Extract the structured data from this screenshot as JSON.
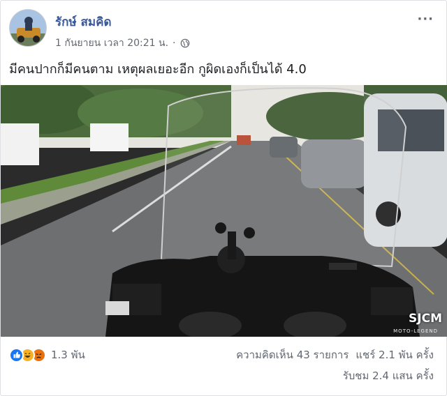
{
  "post": {
    "author": "รักษ์ สมคิด",
    "timestamp": "1 กันยายน เวลา 20:21 น.",
    "separator": "·",
    "privacy_icon": "globe-icon",
    "more_icon": "more-options-icon",
    "more_label": "···",
    "text": "มีคนปากก็มีคนตาม เหตุผลเยอะอีก กูผิดเองก็เป็นได้ 4.0"
  },
  "video": {
    "watermark": "SJCM",
    "watermark_sub": "MOTO-LEGEND"
  },
  "footer": {
    "reaction_icons": [
      "like-icon",
      "haha-icon",
      "angry-icon"
    ],
    "reaction_count": "1.3 พัน",
    "comments": "ความคิดเห็น 43 รายการ",
    "shares": "แชร์ 2.1 พัน ครั้ง",
    "views": "รับชม 2.4 แสน ครั้ง"
  },
  "colors": {
    "link": "#385898",
    "meta": "#616770",
    "like": "#1877f2",
    "haha": "#f7b125",
    "angry": "#e9710f"
  }
}
